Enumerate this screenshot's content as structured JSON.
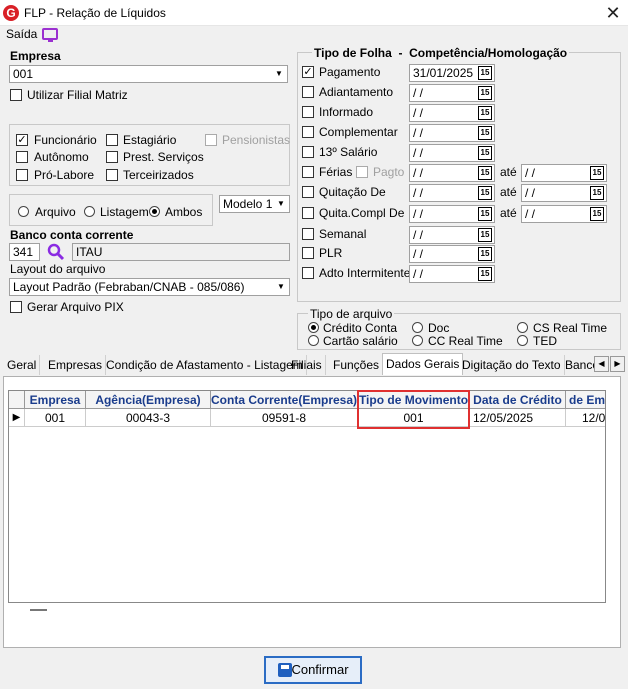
{
  "window": {
    "title": "FLP - Relação de Líquidos",
    "icon_letter": "G"
  },
  "menu": {
    "saida": "Saída"
  },
  "empresa": {
    "label": "Empresa",
    "value": "001",
    "utilizar_filial": "Utilizar Filial Matriz"
  },
  "categorias": {
    "funcionario": "Funcionário",
    "estagiario": "Estagiário",
    "pensionistas": "Pensionistas",
    "autonomo": "Autônomo",
    "prest_servicos": "Prest. Serviços",
    "pro_labore": "Pró-Labore",
    "terceirizados": "Terceirizados"
  },
  "saida_tipo": {
    "arquivo": "Arquivo",
    "listagem": "Listagem",
    "ambos": "Ambos",
    "selected": "Ambos"
  },
  "modelo": {
    "value": "Modelo 1"
  },
  "banco": {
    "label": "Banco conta corrente",
    "code": "341",
    "name": "ITAU"
  },
  "layout": {
    "label": "Layout do arquivo",
    "value": "Layout Padrão (Febraban/CNAB - 085/086)"
  },
  "pix": {
    "label": "Gerar Arquivo PIX"
  },
  "tipo_folha": {
    "header": "Tipo de Folha  -  Competência/Homologação",
    "ate": "até",
    "pagto": "Pagto",
    "cal": "15",
    "items": [
      {
        "label": "Pagamento",
        "checked": true,
        "date": "31/01/2025"
      },
      {
        "label": "Adiantamento",
        "date": "/ /"
      },
      {
        "label": "Informado",
        "date": "/ /"
      },
      {
        "label": "Complementar",
        "date": "/ /"
      },
      {
        "label": "13º Salário",
        "date": "/ /"
      },
      {
        "label": "Férias",
        "date": "/ /",
        "date2": "/ /"
      },
      {
        "label": "Quitação De",
        "date": "/ /",
        "date2": "/ /"
      },
      {
        "label": "Quita.Compl De",
        "date": "/ /",
        "date2": "/ /"
      },
      {
        "label": "Semanal",
        "date": "/ /"
      },
      {
        "label": "PLR",
        "date": "/ /"
      },
      {
        "label": "Adto Intermitente",
        "date": "/ /"
      }
    ]
  },
  "tipo_arquivo": {
    "label": "Tipo de arquivo",
    "credito_conta": "Crédito Conta",
    "doc": "Doc",
    "cs_real_time": "CS Real Time",
    "cartao_salario": "Cartão salário",
    "cc_real_time": "CC Real Time",
    "ted": "TED",
    "selected": "Crédito Conta"
  },
  "tabs": [
    "Geral",
    "Empresas",
    "Condição de Afastamento - Listagem",
    "Filiais",
    "Funções",
    "Dados Gerais",
    "Digitação do Texto",
    "Banco"
  ],
  "active_tab": "Dados Gerais",
  "grid": {
    "headers": [
      "Empresa",
      "Agência(Empresa)",
      "Conta Corrente(Empresa)",
      "Tipo de Movimento",
      "Data de Crédito",
      "de Em"
    ],
    "row": [
      "001",
      "00043-3",
      "09591-8",
      "001",
      "12/05/2025",
      "12/0"
    ]
  },
  "confirm": {
    "label": "Confirmar"
  }
}
